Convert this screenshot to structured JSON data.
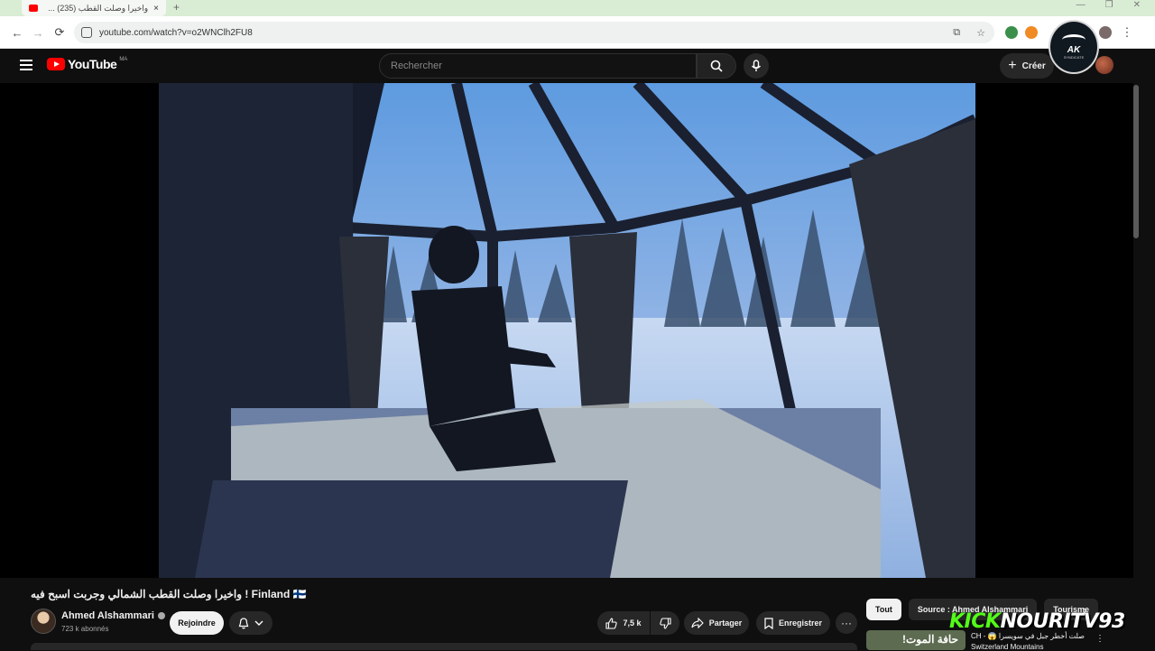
{
  "browser": {
    "tab_title": "واخيرا وصلت القطب (235) ...",
    "tab_close": "×",
    "new_tab": "+",
    "url": "youtube.com/watch?v=o2WNClh2FU8",
    "nav": {
      "back": "←",
      "forward": "→",
      "reload": "⟳"
    },
    "omni_icons": {
      "install": "⧉",
      "bookmark": "☆"
    },
    "menu": "⋮",
    "window_controls": [
      "—",
      "❐",
      "✕"
    ]
  },
  "header": {
    "logo_text": "YouTube",
    "country_code": "MA",
    "search_placeholder": "Rechercher",
    "create_label": "Créer",
    "create_plus": "+"
  },
  "overlay_badge": {
    "text": "AK",
    "subtext": "SYNDICATE"
  },
  "video": {
    "title": "واخيرا وصلت القطب الشمالي وجربت اسبح فيه ! Finland 🇫🇮",
    "channel": {
      "name": "Ahmed Alshammari",
      "subscribers": "723 k abonnés",
      "join_label": "Rejoindre"
    },
    "actions": {
      "likes": "7,5 k",
      "share_label": "Partager",
      "save_label": "Enregistrer",
      "more": "···"
    }
  },
  "sidebar": {
    "chips": [
      "Tout",
      "Source : Ahmed Alshammari",
      "Tourisme"
    ],
    "chip_next": "›",
    "recommendation": {
      "thumb_text": "حافة الموت!",
      "title_line1": "صلت أخطر جبل في سويسرا 😱 - CH",
      "title_line2": "Switzerland Mountains",
      "more": "⋮"
    }
  },
  "watermark": {
    "part1": "KICK",
    "part2": "NOURITV93"
  },
  "colors": {
    "brand_red": "#ff0000",
    "kick_green": "#53fc18",
    "background": "#0f0f0f"
  }
}
